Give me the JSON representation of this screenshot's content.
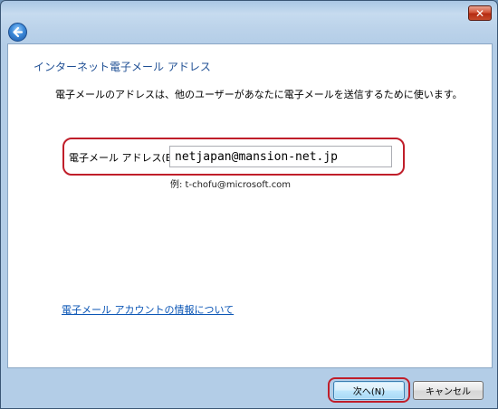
{
  "window": {
    "close_glyph": "✕"
  },
  "wizard": {
    "heading": "インターネット電子メール アドレス",
    "description": "電子メールのアドレスは、他のユーザーがあなたに電子メールを送信するために使います。",
    "email_label": "電子メール アドレス(E):",
    "email_value": "netjapan@mansion-net.jp",
    "example": "例: t-chofu@microsoft.com",
    "info_link": "電子メール アカウントの情報について"
  },
  "buttons": {
    "next": "次へ(N)",
    "cancel": "キャンセル"
  },
  "colors": {
    "highlight_ring": "#c01e2a",
    "heading": "#1f4f94",
    "link": "#0a55b5"
  }
}
